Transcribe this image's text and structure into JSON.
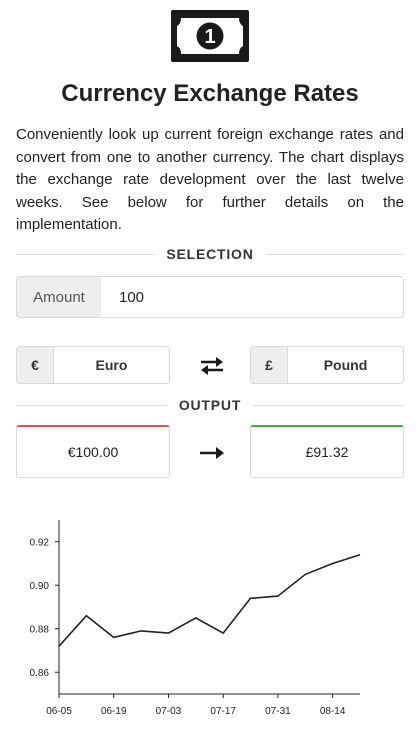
{
  "header": {
    "title": "Currency Exchange Rates",
    "description": "Conveniently look up current foreign exchange rates and convert from one to another currency. The chart displays the exchange rate development over the last twelve weeks. See below for further details on the implementation.",
    "logo_icon": "banknote-icon",
    "logo_digit": "1"
  },
  "selection": {
    "heading": "SELECTION",
    "amount_label": "Amount",
    "amount_value": "100",
    "from": {
      "symbol": "€",
      "name": "Euro"
    },
    "to": {
      "symbol": "£",
      "name": "Pound"
    },
    "swap_icon": "swap-arrows-icon"
  },
  "output": {
    "heading": "OUTPUT",
    "from_value": "€100.00",
    "to_value": "£91.32",
    "arrow_icon": "right-arrow-icon",
    "from_accent": "#d9534f",
    "to_accent": "#3cb043"
  },
  "chart_data": {
    "type": "line",
    "x": [
      "06-05",
      "06-12",
      "06-19",
      "06-26",
      "07-03",
      "07-10",
      "07-17",
      "07-24",
      "07-31",
      "08-07",
      "08-14",
      "08-21"
    ],
    "values": [
      0.872,
      0.886,
      0.876,
      0.879,
      0.878,
      0.885,
      0.878,
      0.894,
      0.895,
      0.905,
      0.91,
      0.914
    ],
    "xtick_labels": [
      "06-05",
      "06-19",
      "07-03",
      "07-17",
      "07-31",
      "08-14"
    ],
    "yticks": [
      0.86,
      0.88,
      0.9,
      0.92
    ],
    "ytick_labels": [
      "0.86",
      "0.88",
      "0.90",
      "0.92"
    ],
    "ylim": [
      0.85,
      0.93
    ],
    "title": "",
    "xlabel": "",
    "ylabel": "",
    "grid": false,
    "line_color": "#222222"
  }
}
